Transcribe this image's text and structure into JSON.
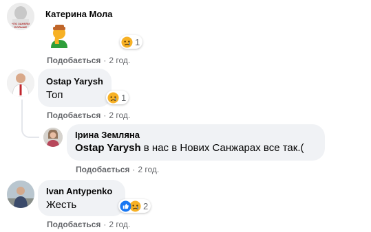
{
  "comments": [
    {
      "author": "Катерина Мола",
      "avatar_caption": "ЧТО ЗАНЯЛИ БОЛЬШЕ",
      "emoji": "facepalm-emoji",
      "reactions": {
        "icons": [
          "sad-reaction"
        ],
        "count": "1"
      },
      "like": "Подобається",
      "sep": "·",
      "time": "2 год."
    },
    {
      "author": "Ostap Yarysh",
      "text": "Топ",
      "reactions": {
        "icons": [
          "sad-reaction"
        ],
        "count": "1"
      },
      "like": "Подобається",
      "sep": "·",
      "time": "2 год."
    },
    {
      "author": "Ірина Земляна",
      "mention": "Ostap Yarysh",
      "text": " в нас в Нових Санжарах все так.(",
      "like": "Подобається",
      "sep": "·",
      "time": "2 год.",
      "is_reply": true
    },
    {
      "author": "Ivan Antypenko",
      "text": "Жесть",
      "reactions": {
        "icons": [
          "like-reaction",
          "sad-reaction"
        ],
        "count": "2"
      },
      "like": "Подобається",
      "sep": "·",
      "time": "2 год."
    }
  ],
  "colors": {
    "bubble": "#f0f2f5",
    "meta": "#65676b",
    "like_blue": "#1877f2",
    "emoji_yellow": "#f7b125"
  }
}
